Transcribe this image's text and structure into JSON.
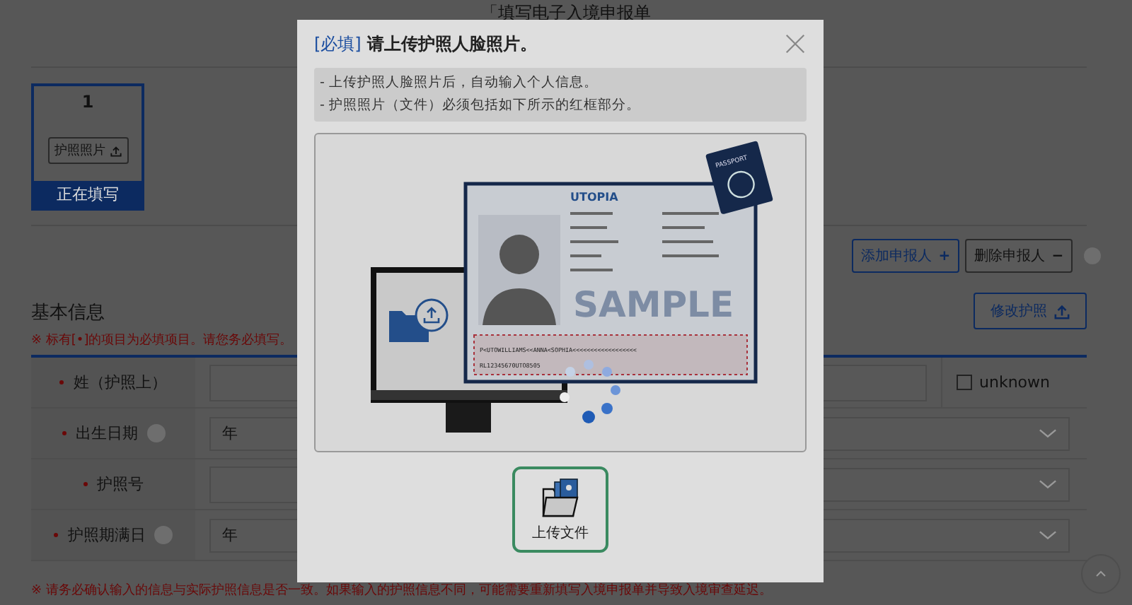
{
  "page": {
    "title": "「填写电子入境申报单"
  },
  "applicants": [
    {
      "number": "1",
      "photo_button": "护照照片",
      "status": "正在填写",
      "selected": true
    }
  ],
  "applicant_actions": [
    {
      "label": "添加申报人",
      "symbol": "+"
    },
    {
      "label": "删除申报人",
      "symbol": "−"
    }
  ],
  "section": {
    "title": "基本信息",
    "note": "※ 标有[•]的项目为必填项目。请您务必填写。",
    "edit_button": "修改护照"
  },
  "fields": [
    {
      "label": "姓（护照上）",
      "kind": "name",
      "help": false,
      "checkbox": {
        "label": "unknown",
        "checked": false
      }
    },
    {
      "label": "出生日期",
      "kind": "date",
      "help": true,
      "select": "年"
    },
    {
      "label": "护照号",
      "kind": "passport",
      "help": false
    },
    {
      "label": "护照期满日",
      "kind": "date",
      "help": true,
      "select": "年"
    }
  ],
  "warning": "※ 请务必确认输入的信息与实际护照信息是否一致。如果输入的护照信息不同，可能需要重新填写入境申报单并导致入境审查延迟。",
  "modal": {
    "required_tag": "[必填]",
    "title": "请上传护照人脸照片。",
    "notes": [
      "- 上传护照人脸照片后，自动输入个人信息。",
      "- 护照照片（文件）必须包括如下所示的红框部分。"
    ],
    "illustration": {
      "country": "UTOPIA",
      "watermark": "SAMPLE",
      "booklet": "PASSPORT",
      "mrz": [
        "P<UTOWILLIAMS<<ANNA<SOPHIA<<<<<<<<<<<<<<<<<<",
        "RL12345670UTO8505"
      ]
    },
    "upload_button": "上传文件"
  }
}
